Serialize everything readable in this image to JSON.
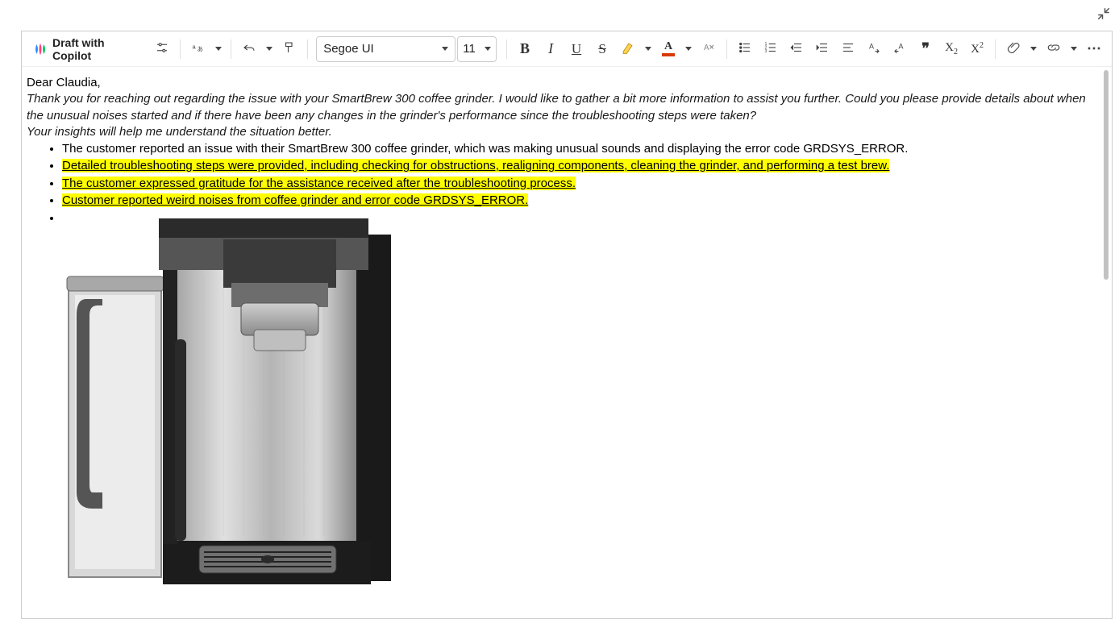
{
  "collapse_tooltip": "Collapse",
  "toolbar": {
    "copilot_label": "Draft with Copilot",
    "font_family": "Segoe UI",
    "font_size": "11",
    "bold_glyph": "B",
    "italic_glyph": "I",
    "underline_glyph": "U",
    "strike_glyph": "S",
    "fontcolor_glyph": "A",
    "subscript_glyph": "X",
    "subscript_sub": "2",
    "superscript_glyph": "X",
    "superscript_sup": "2",
    "quote_glyph": "❞",
    "more_glyph": "⋯"
  },
  "content": {
    "salutation": "Dear Claudia,",
    "intro_line1": "Thank you for reaching out regarding the issue with your SmartBrew 300 coffee grinder. I would like to gather a bit more information to assist you further. Could you please provide details about when the unusual noises started and if there have been any changes in the grinder's performance since the troubleshooting steps were taken?",
    "intro_line2": "Your insights will help me understand the situation better.",
    "bullets": [
      {
        "text": "The customer reported an issue with their SmartBrew 300 coffee grinder, which was making unusual sounds and displaying the error code GRDSYS_ERROR.",
        "highlight": false
      },
      {
        "text": "Detailed troubleshooting steps were provided, including checking for obstructions, realigning components, cleaning the grinder, and performing a test brew.",
        "highlight": true
      },
      {
        "text": "The customer expressed gratitude for the assistance received after the troubleshooting process.",
        "highlight": true
      },
      {
        "text": "Customer reported weird noises from coffee grinder and error code GRDSYS_ERROR.",
        "highlight": true
      }
    ]
  }
}
